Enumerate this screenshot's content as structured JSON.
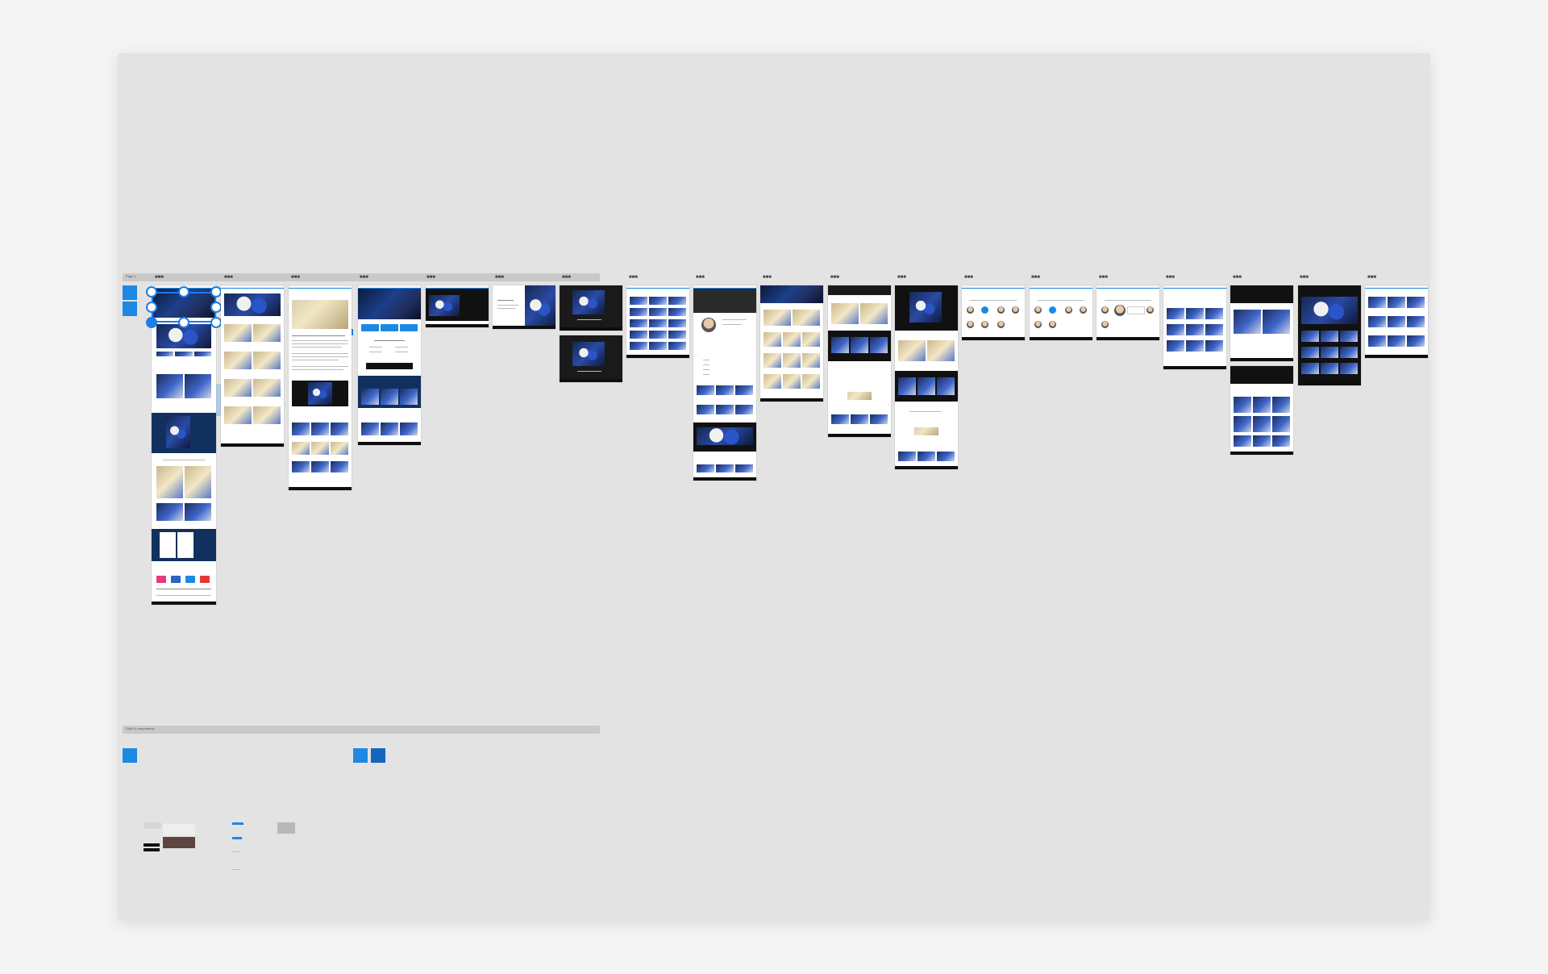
{
  "canvas": {
    "page_label": "Page 1",
    "section_top_label": "",
    "section_bottom_label": "Style & components",
    "frame_marker": "■■■",
    "bottom_note_1": "",
    "bottom_note_2": ""
  },
  "colors": {
    "background": "#f4f4f4",
    "board": "#e3e3e3",
    "accent": "#1e7ce6",
    "swatch_blue": "#1e88e5",
    "swatch_dark_blue": "#1565c0",
    "navy": "#12305e"
  },
  "icons": {
    "selection_handle": "selection-handle-icon",
    "frame_marker": "frame-menu-icon"
  }
}
